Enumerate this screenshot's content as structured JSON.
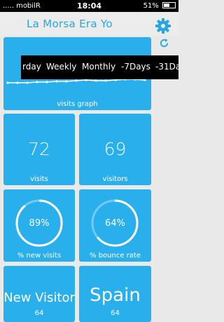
{
  "status_bar": {
    "carrier": "..... mobilR",
    "time": "18:04",
    "battery": "51%"
  },
  "header": {
    "title": "La Morsa Era Yo",
    "settings_icon": "gear-icon",
    "refresh_icon": "refresh-icon"
  },
  "graph_tile": {
    "label": "visits graph",
    "chart_type": "line"
  },
  "period_selector": {
    "options": [
      "rday",
      "Weekly",
      "Monthly",
      "-7Days",
      "-31Da"
    ]
  },
  "visits_tile": {
    "value": "72",
    "label": "visits"
  },
  "visitors_tile": {
    "value": "69",
    "label": "visitors"
  },
  "new_visits_tile": {
    "value": "89%",
    "label": "% new visits",
    "percent": 89
  },
  "bounce_tile": {
    "value": "64%",
    "label": "% bounce rate",
    "percent": 64
  },
  "visitor_type_tile": {
    "value": "New Visitor",
    "count": "64"
  },
  "country_tile": {
    "value": "Spain",
    "count": "64"
  },
  "colors": {
    "accent": "#29b0ec",
    "title": "#27a7df",
    "background": "#e9e9e9"
  }
}
